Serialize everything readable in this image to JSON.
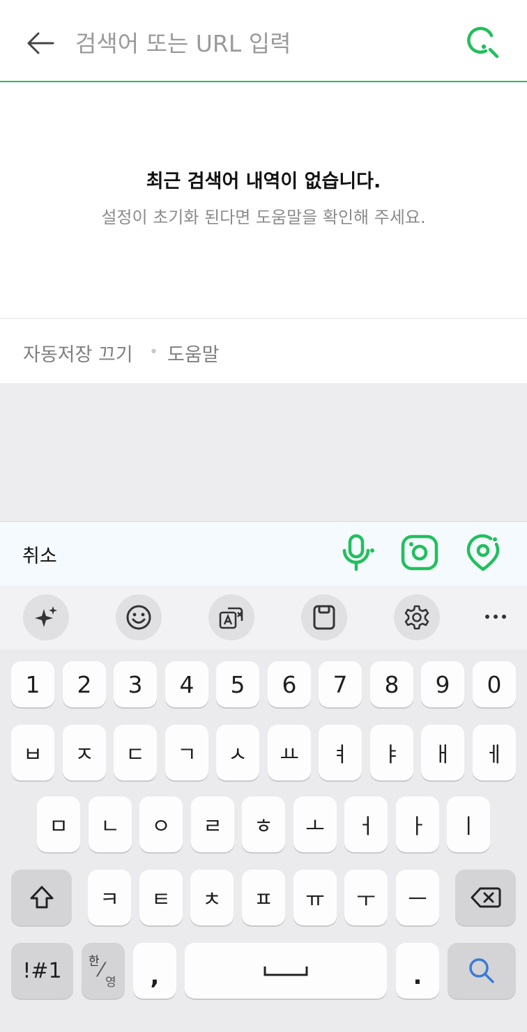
{
  "search": {
    "placeholder": "검색어 또는 URL 입력",
    "value": ""
  },
  "empty_state": {
    "title": "최근 검색어 내역이 없습니다.",
    "subtitle": "설정이 초기화 된다면 도움말을 확인해 주세요."
  },
  "footer_links": {
    "autosave_off": "자동저장 끄기",
    "separator": "•",
    "help": "도움말"
  },
  "toolbar": {
    "cancel": "취소",
    "icons": [
      "microphone-icon",
      "camera-lens-icon",
      "location-pin-icon"
    ]
  },
  "keyboard_tools": {
    "icons": [
      "sparkle-ai-icon",
      "emoji-icon",
      "translate-icon",
      "clipboard-icon",
      "settings-icon",
      "more-icon"
    ],
    "more": "⋯"
  },
  "keyboard": {
    "numbers": [
      "1",
      "2",
      "3",
      "4",
      "5",
      "6",
      "7",
      "8",
      "9",
      "0"
    ],
    "row1": [
      "ㅂ",
      "ㅈ",
      "ㄷ",
      "ㄱ",
      "ㅅ",
      "ㅛ",
      "ㅕ",
      "ㅑ",
      "ㅐ",
      "ㅔ"
    ],
    "row2": [
      "ㅁ",
      "ㄴ",
      "ㅇ",
      "ㄹ",
      "ㅎ",
      "ㅗ",
      "ㅓ",
      "ㅏ",
      "ㅣ"
    ],
    "row3": [
      "ㅋ",
      "ㅌ",
      "ㅊ",
      "ㅍ",
      "ㅠ",
      "ㅜ",
      "ㅡ"
    ],
    "symbols": "!#1",
    "lang_top": "한",
    "lang_bottom": "영",
    "comma": ",",
    "period": "."
  },
  "colors": {
    "accent": "#20c05c",
    "search_key_icon": "#3a7bd5"
  }
}
